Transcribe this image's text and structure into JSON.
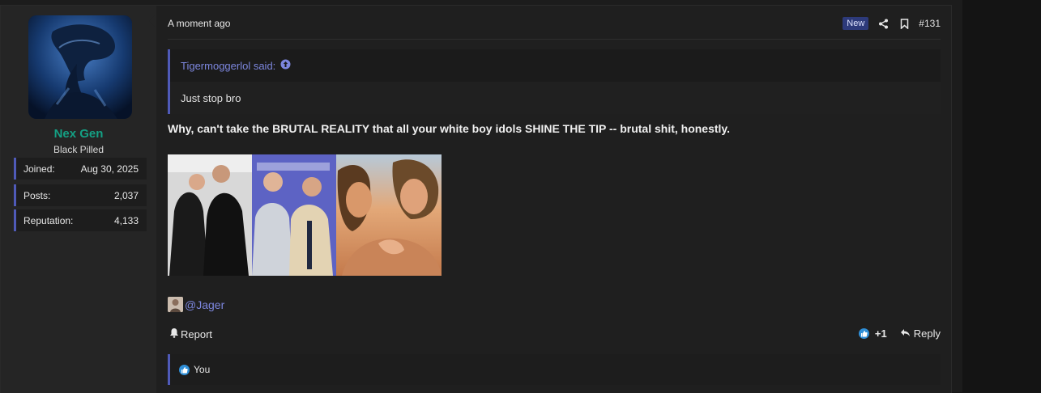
{
  "user": {
    "name": "Nex Gen",
    "title": "Black Pilled",
    "stats": [
      {
        "label": "Joined:",
        "value": "Aug 30, 2025"
      },
      {
        "label": "Posts:",
        "value": "2,037"
      },
      {
        "label": "Reputation:",
        "value": "4,133"
      }
    ]
  },
  "post": {
    "date": "A moment ago",
    "new_badge": "New",
    "number": "#131",
    "quote": {
      "author_line": "Tigermoggerlol said:",
      "text": "Just stop bro"
    },
    "message": "Why, can't take the BRUTAL REALITY that all your white boy idols SHINE THE TIP -- brutal shit, honestly.",
    "mention": "@Jager",
    "actions": {
      "report": "Report",
      "like_count": "+1",
      "reply": "Reply"
    },
    "reactions_summary": "You"
  },
  "colors": {
    "accent": "#4f5ab8",
    "username": "#14a084",
    "link": "#7c86dd",
    "like": "#2f8fd8"
  }
}
